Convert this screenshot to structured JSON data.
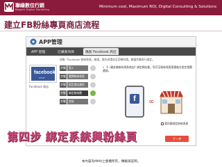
{
  "brand": {
    "name": "聯緣數位行銷",
    "sub": "Magnet Digital Marketing",
    "slogan": "Minimum cost, Maximum ROI, Digital Consulting & Solutions"
  },
  "slide_title": "建立FB粉絲專頁商店流程",
  "app": {
    "title": "APP管理",
    "tabs": [
      {
        "label": "APP 管理"
      },
      {
        "label": "已購買項目"
      },
      {
        "label": "購買 Facebook 商店"
      }
    ],
    "notice": "如無「Facebook 粉絲專頁」帳號，請先申請並至官網申請，開通完畢再行綁定。",
    "fb_card": {
      "word": "facebook",
      "sub": "SHOP",
      "caption": "Facebook 商店"
    },
    "steps": [
      {
        "num": "步驟 1",
        "label": "登入 Facebook"
      },
      {
        "num": "步驟 2",
        "label": "選擇粉絲專頁"
      },
      {
        "num": "步驟 3",
        "label": "設定商店資料"
      },
      {
        "num": "步驟 4",
        "label": "綁定粉絲團"
      },
      {
        "num": "步驟 5",
        "label": "完成"
      }
    ],
    "instruction": "【一鍵安裝粉絲專頁商店】綁定網站後，您可至粉絲專頁管理後台設定相關選項。",
    "checkbox_label": "我同意綁定粉絲專頁",
    "next_button": "下一步"
  },
  "headline": "第四步 綁定系統與粉絲頁",
  "footer": "本內容為MMA之版權所有，轉載請註明。",
  "colors": {
    "brand": "#8a1b3c",
    "accent": "#c0392b",
    "facebook": "#3b5998",
    "success": "#7ab648"
  }
}
